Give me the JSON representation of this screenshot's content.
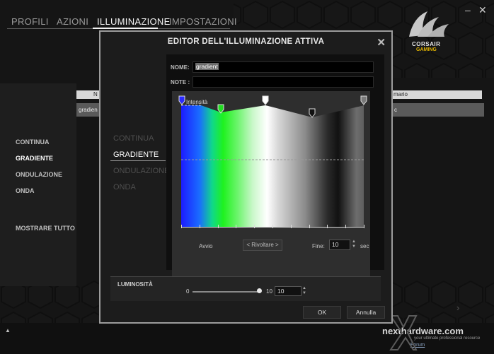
{
  "tabs": [
    {
      "label": "PROFILI"
    },
    {
      "label": "AZIONI"
    },
    {
      "label": "ILLUMINAZIONE"
    },
    {
      "label": "IMPOSTAZIONI"
    }
  ],
  "window": {
    "minimize": "–",
    "close": "✕"
  },
  "brand": {
    "line1": "CORSAIR",
    "line2": "GAMING"
  },
  "left_menu": [
    "CONTINUA",
    "GRADIENTE",
    "ONDULAZIONE",
    "ONDA",
    "MOSTRARE TUTTO"
  ],
  "bg_table": {
    "col1_header": "N",
    "col2_header": "mario",
    "row1_col1": "gradien",
    "row1_col2": "c"
  },
  "modal": {
    "title": "EDITOR DELL'ILLUMINAZIONE ATTIVA",
    "close": "✕",
    "menu": [
      "CONTINUA",
      "GRADIENTE",
      "ONDULAZIONE",
      "ONDA"
    ],
    "name_label": "NOME:",
    "name_value": "gradient",
    "note_label": "NOTE :",
    "intensity_label": "Intensità",
    "start_label": "Avvio",
    "reverse_button": "< Rivoltare >",
    "end_label": "Fine:",
    "end_value": "10",
    "end_unit": "sec",
    "brightness_label": "LUMINOSITÀ",
    "brightness_min": "0",
    "brightness_max": "10",
    "brightness_value": "10",
    "ok": "OK",
    "cancel": "Annulla"
  },
  "stops": [
    {
      "color": "#2a2aff"
    },
    {
      "color": "#22dd22"
    },
    {
      "color": "#ffffff"
    },
    {
      "color": "#111111"
    },
    {
      "color": "#7a7a7a"
    }
  ],
  "watermark": {
    "brand": "nexthardware.com",
    "tagline": "your ultimate professional resource",
    "forum": "Forum"
  },
  "colors": {
    "accent": "#ffffff",
    "background": "#151515",
    "modal_border": "#9c9c9c"
  }
}
